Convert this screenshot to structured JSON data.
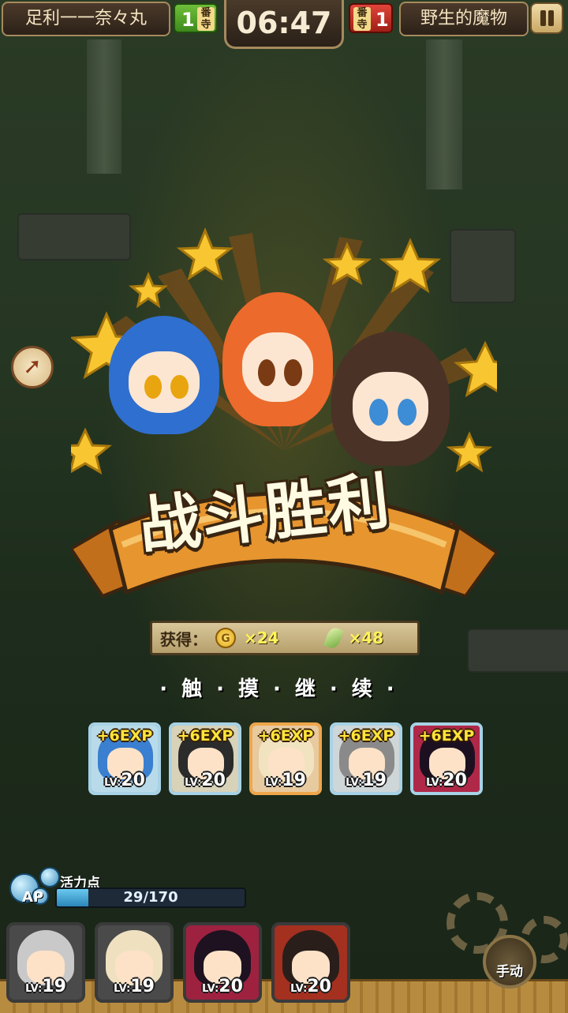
{
  "header": {
    "left_player": "足利一一奈々丸",
    "left_score": "1",
    "left_score_tag": "番寺",
    "timer": "06:47",
    "right_score": "1",
    "right_score_tag": "番寺",
    "right_player": "野生的魔物"
  },
  "victory": {
    "title": "战斗胜利"
  },
  "rewards": {
    "label": "获得：",
    "gold_icon": "G",
    "gold": "×24",
    "feather": "×48"
  },
  "prompt": "·触·摸·继·续·",
  "exp_cards": [
    {
      "exp": "+6EXP",
      "lv_prefix": "LV:",
      "lv": "20",
      "color": "#3a7fd0"
    },
    {
      "exp": "+6EXP",
      "lv_prefix": "LV:",
      "lv": "20",
      "color": "#2b2b2b"
    },
    {
      "exp": "+6EXP",
      "lv_prefix": "LV:",
      "lv": "19",
      "color": "#f2e3c0"
    },
    {
      "exp": "+6EXP",
      "lv_prefix": "LV:",
      "lv": "19",
      "color": "#8a8a8a"
    },
    {
      "exp": "+6EXP",
      "lv_prefix": "LV:",
      "lv": "20",
      "color": "#1c1020"
    }
  ],
  "ap": {
    "label": "活力点",
    "short": "AP",
    "value": "29/170",
    "fraction": 0.17
  },
  "team": [
    {
      "lv_prefix": "LV:",
      "lv": "19",
      "color": "#c9c9c9"
    },
    {
      "lv_prefix": "LV:",
      "lv": "19",
      "color": "#efe1c0"
    },
    {
      "lv_prefix": "LV:",
      "lv": "20",
      "color": "#1e1220"
    },
    {
      "lv_prefix": "LV:",
      "lv": "20",
      "color": "#2a1e1a"
    }
  ],
  "manual_button": "手动",
  "icons": {
    "pause": "pause-icon",
    "skip": "skip-arrow-icon",
    "gold": "gold-coin-icon",
    "feather": "feather-icon",
    "settings": "gear-icon"
  }
}
